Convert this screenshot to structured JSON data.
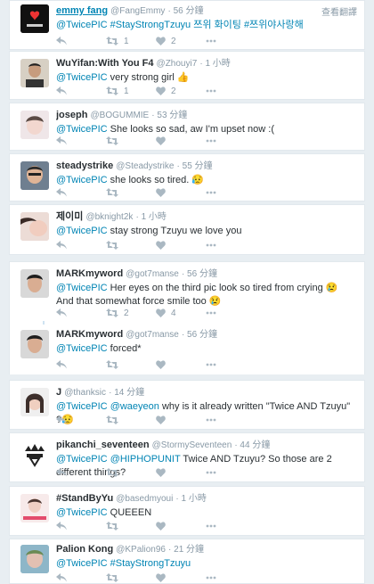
{
  "translate_label": "查看翻譯",
  "tweets": [
    {
      "name": "emmy fang",
      "handle": "@FangEmmy",
      "time": "· 56 分鐘",
      "mention": "@TwicePIC",
      "text": " #StayStrongTzuyu 쯔위 화이팅 #쯔위야사랑해",
      "retweets": "1",
      "likes": "2"
    },
    {
      "name": "WuYifan:With You F4",
      "handle": "@Zhouyi7",
      "time": "· 1 小時",
      "mention": "@TwicePIC",
      "text": " very strong girl 👍",
      "retweets": "1",
      "likes": "2"
    },
    {
      "name": "joseph",
      "handle": "@BOGUMMIE",
      "time": "· 53 分鐘",
      "mention": "@TwicePIC",
      "text": " She looks so sad, aw I'm upset now :(",
      "retweets": "",
      "likes": ""
    },
    {
      "name": "steadystrike",
      "handle": "@Steadystrike",
      "time": "· 55 分鐘",
      "mention": "@TwicePIC",
      "text": " she looks so tired. 😥",
      "retweets": "",
      "likes": ""
    },
    {
      "name": "제이미",
      "handle": "@bknight2k",
      "time": "· 1 小時",
      "mention": "@TwicePIC",
      "text": " stay strong Tzuyu we love you",
      "retweets": "",
      "likes": ""
    },
    {
      "name": "MARKmyword",
      "handle": "@got7manse",
      "time": "· 56 分鐘",
      "mention": "@TwicePIC",
      "text": " Her eyes on the third pic look so tired from crying 😢 And that somewhat force smile too 😢",
      "retweets": "2",
      "likes": "4"
    },
    {
      "name": "MARKmyword",
      "handle": "@got7manse",
      "time": "· 56 分鐘",
      "mention": "@TwicePIC",
      "text": " forced*",
      "retweets": "",
      "likes": ""
    },
    {
      "name": "J",
      "handle": "@thanksic",
      "time": "· 14 分鐘",
      "mention": "@TwicePIC",
      "mention2": "@waeyeon",
      "text": " why is it already written \"Twice AND Tzuyu\" ?😥",
      "retweets": "",
      "likes": ""
    },
    {
      "name": "pikanchi_seventeen",
      "handle": "@StormySeventeen",
      "time": "· 44 分鐘",
      "mention": "@TwicePIC",
      "mention2": "@HIPHOPUNIT",
      "text": " Twice AND Tzuyu? So those are 2 different things?",
      "retweets": "",
      "likes": ""
    },
    {
      "name": "#StandByYu",
      "handle": "@basedmyoui",
      "time": "· 1 小時",
      "mention": "@TwicePIC",
      "text": " QUEEEN",
      "retweets": "",
      "likes": ""
    },
    {
      "name": "Palion Kong",
      "handle": "@KPalion96",
      "time": "· 21 分鐘",
      "mention": "@TwicePIC",
      "text": " #StayStrongTzuyu",
      "retweets": "",
      "likes": ""
    }
  ]
}
